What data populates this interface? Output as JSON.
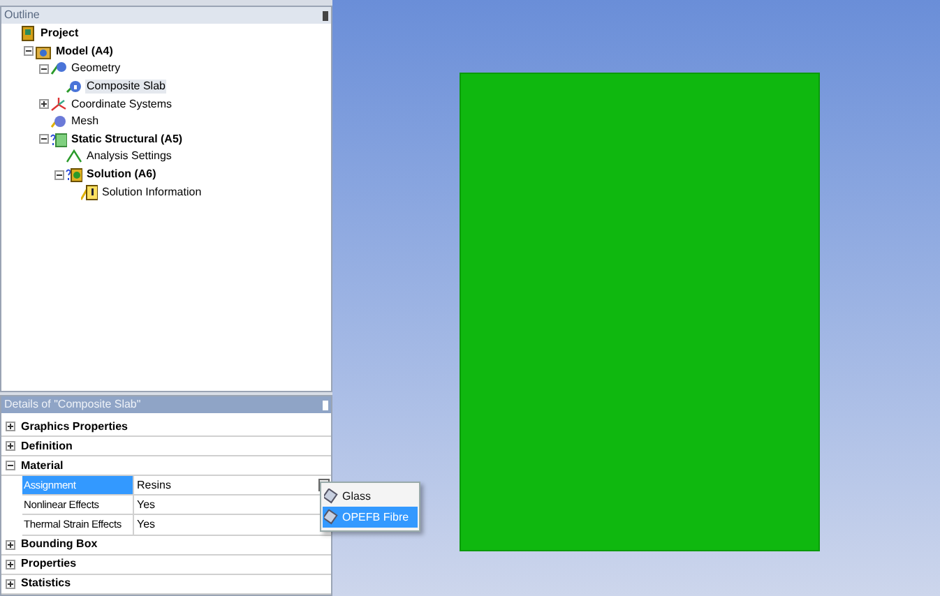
{
  "outline": {
    "title": "Outline",
    "tree": [
      {
        "label": "Project",
        "kind": "project",
        "bold": true,
        "selected": false,
        "children": [
          {
            "label": "Model (A4)",
            "kind": "model",
            "bold": true,
            "expanded": true,
            "selected": false,
            "children": [
              {
                "label": "Geometry",
                "kind": "geometry",
                "bold": false,
                "expanded": true,
                "selected": false,
                "children": [
                  {
                    "label": "Composite Slab",
                    "kind": "body",
                    "bold": false,
                    "selected": true
                  }
                ]
              },
              {
                "label": "Coordinate Systems",
                "kind": "coordinates",
                "bold": false,
                "expanded": false,
                "selected": false
              },
              {
                "label": "Mesh",
                "kind": "mesh",
                "bold": false,
                "selected": false
              },
              {
                "label": "Static Structural (A5)",
                "kind": "analysis",
                "bold": true,
                "expanded": true,
                "selected": false,
                "children": [
                  {
                    "label": "Analysis Settings",
                    "kind": "settings",
                    "bold": false,
                    "selected": false
                  },
                  {
                    "label": "Solution (A6)",
                    "kind": "solution",
                    "bold": true,
                    "expanded": true,
                    "selected": false,
                    "children": [
                      {
                        "label": "Solution Information",
                        "kind": "info",
                        "bold": false,
                        "selected": false
                      }
                    ]
                  }
                ]
              }
            ]
          }
        ]
      }
    ]
  },
  "details": {
    "title": "Details of \"Composite Slab\"",
    "sections": [
      {
        "label": "Graphics Properties",
        "expanded": false
      },
      {
        "label": "Definition",
        "expanded": false
      },
      {
        "label": "Material",
        "expanded": true,
        "rows": [
          {
            "name": "Assignment",
            "value": "Resins",
            "selected": true
          },
          {
            "name": "Nonlinear Effects",
            "value": "Yes",
            "selected": false
          },
          {
            "name": "Thermal Strain Effects",
            "value": "Yes",
            "selected": false
          }
        ]
      },
      {
        "label": "Bounding Box",
        "expanded": false
      },
      {
        "label": "Properties",
        "expanded": false
      },
      {
        "label": "Statistics",
        "expanded": false
      }
    ]
  },
  "material_menu": [
    {
      "label": "Glass",
      "selected": false
    },
    {
      "label": "OPEFB Fibre",
      "selected": true
    }
  ]
}
